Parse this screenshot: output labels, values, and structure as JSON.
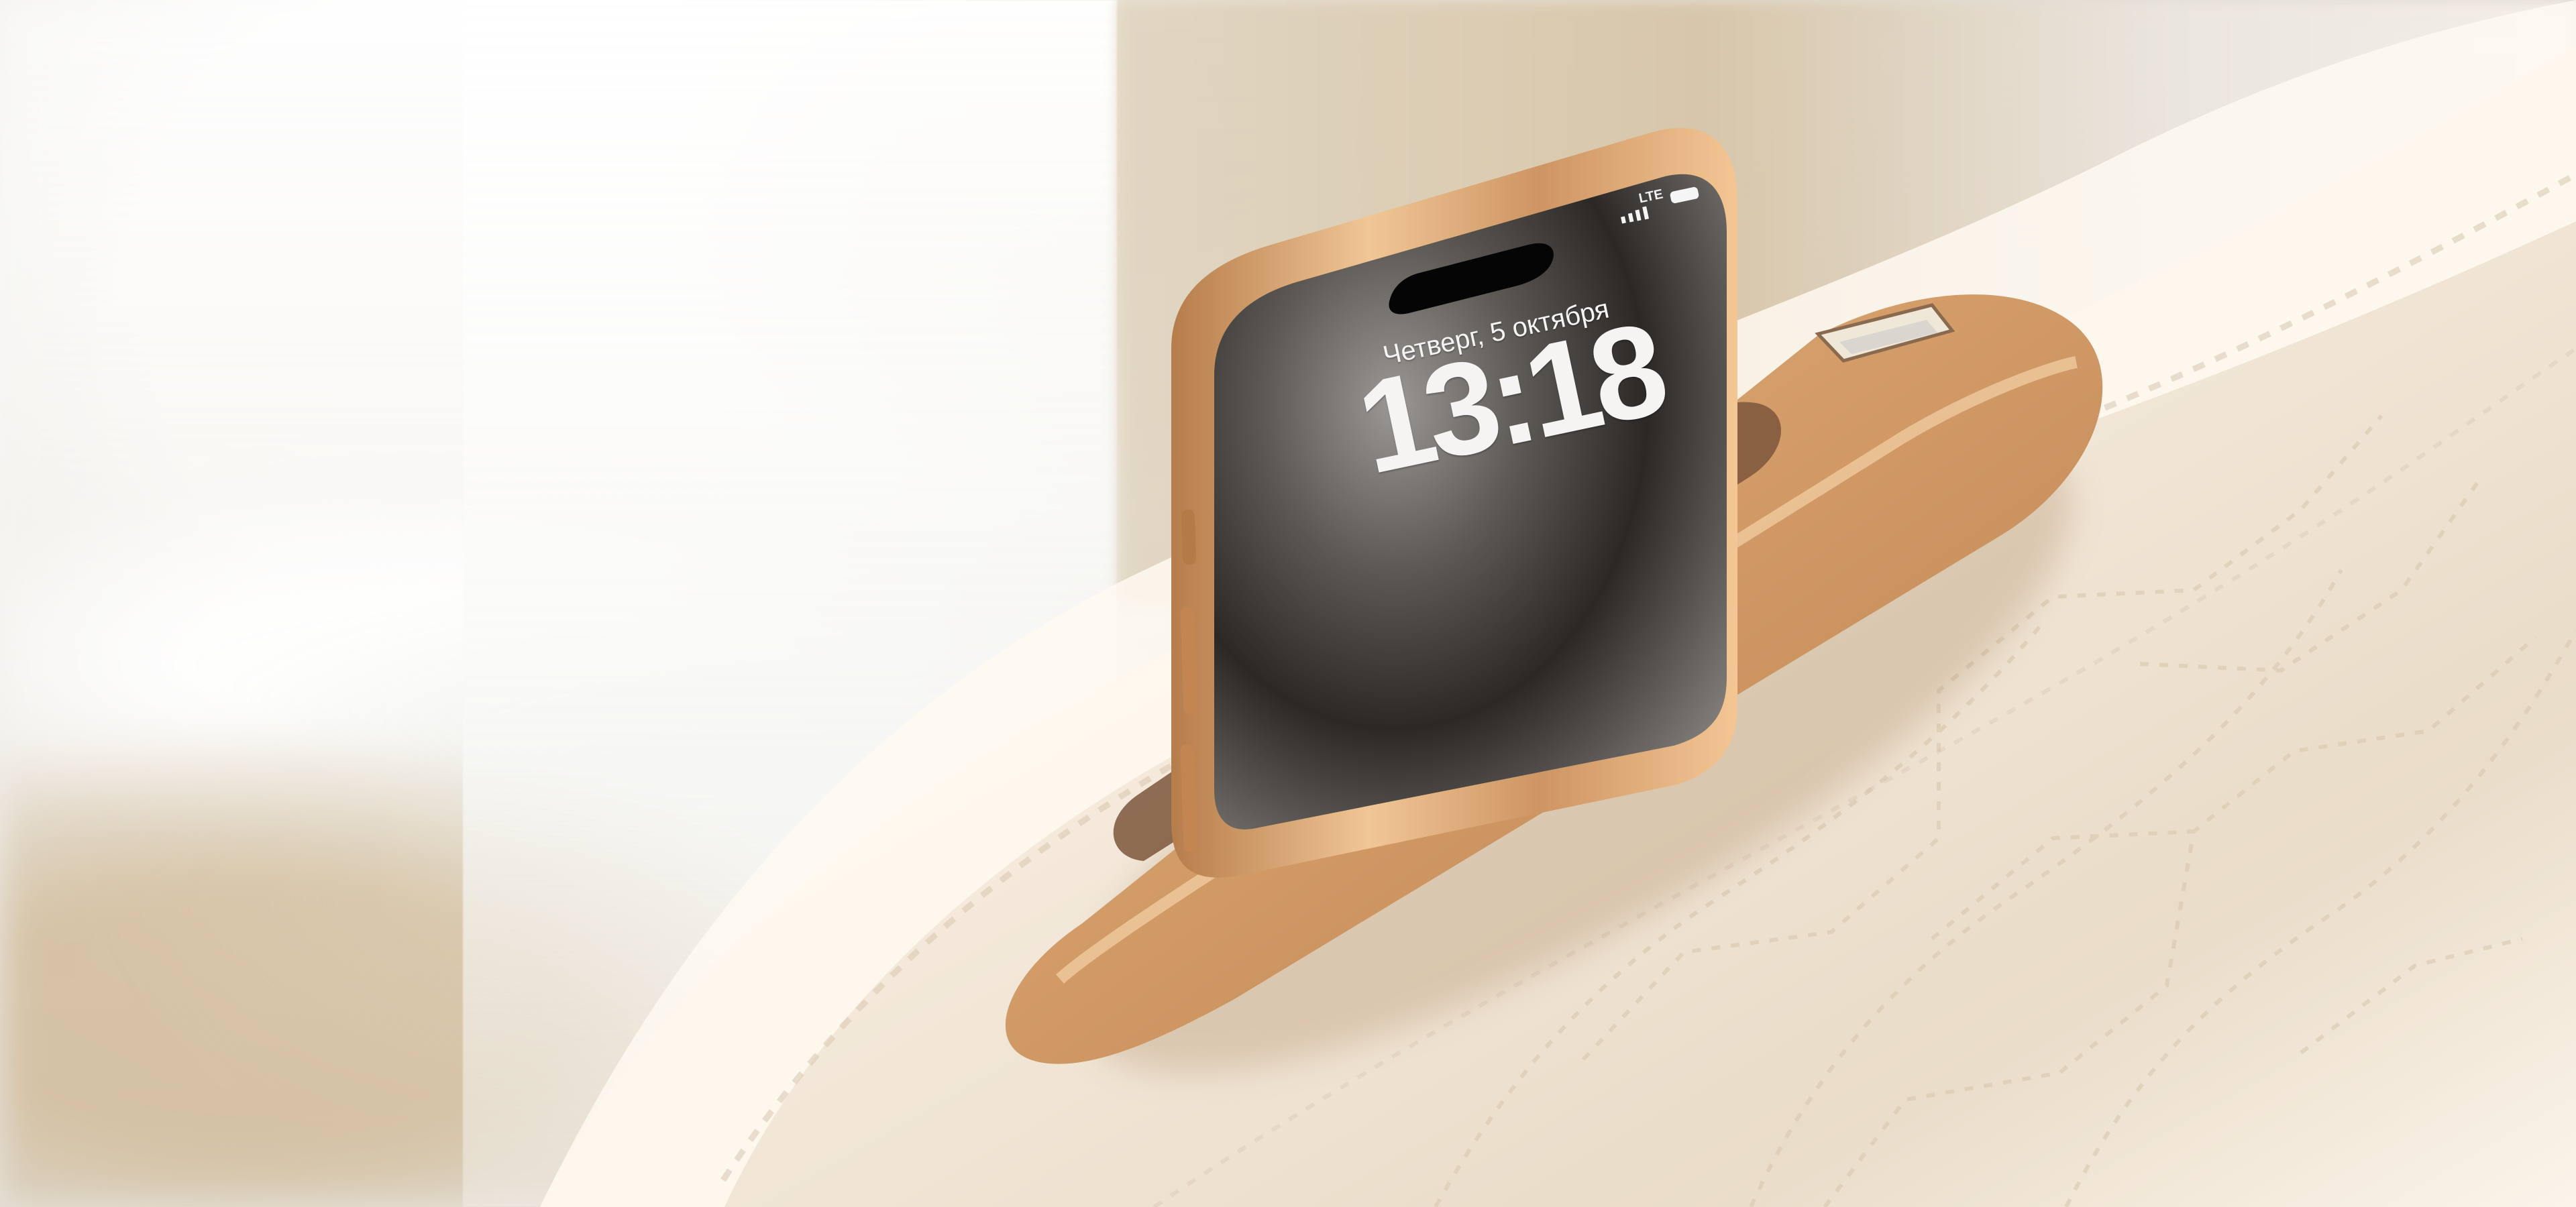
{
  "phone": {
    "date": "Четверг, 5 октября",
    "time": "13:18",
    "status_network": "LTE"
  },
  "icons": {
    "signal": "signal-bars-icon",
    "battery": "battery-icon",
    "usb": "usb-port-icon"
  },
  "colors": {
    "chair_leather": "#f4eadc",
    "chair_shadow": "#ddd0bd",
    "phone_frame": "#d59a5b",
    "phone_screen": "#2d2926",
    "holder_gold": "#d9a66e"
  }
}
